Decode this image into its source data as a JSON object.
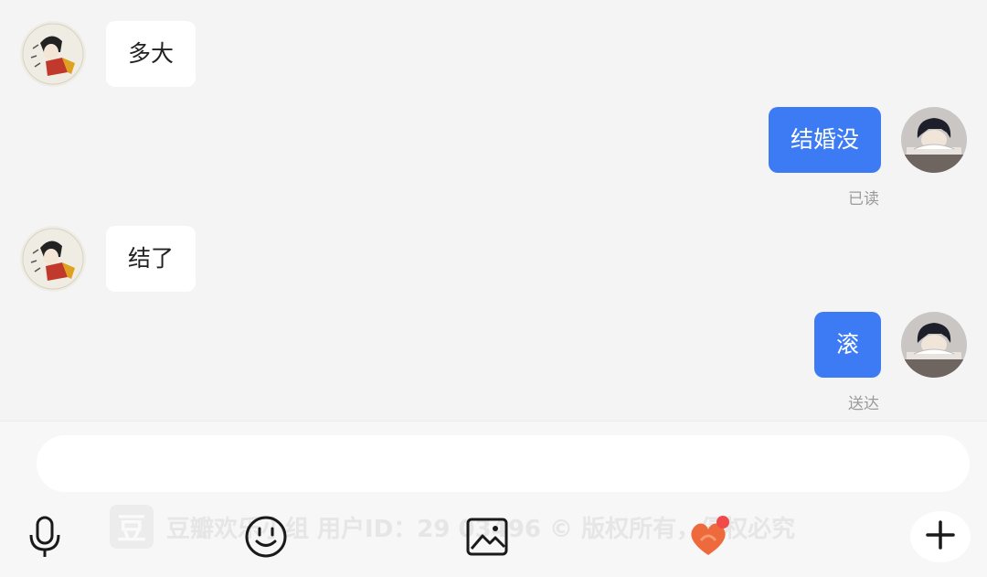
{
  "messages": [
    {
      "direction": "in",
      "text": "多大"
    },
    {
      "direction": "out",
      "text": "结婚没",
      "status": "已读"
    },
    {
      "direction": "in",
      "text": "结了"
    },
    {
      "direction": "out",
      "text": "滚",
      "status": "送达"
    }
  ],
  "composer": {
    "input_value": "",
    "placeholder": ""
  },
  "watermark": {
    "logo": "豆",
    "text": "豆瓣欢乐小组  用户ID：29  03496   © 版权所有，侵权必究"
  },
  "toolbar": {
    "icons": [
      "microphone-icon",
      "emoji-icon",
      "image-icon",
      "heart-sticker-icon",
      "plus-icon"
    ]
  },
  "colors": {
    "accent": "#3d7bf5",
    "background": "#f4f4f4",
    "bubble_in": "#ffffff",
    "status_text": "#9a9a9a"
  }
}
